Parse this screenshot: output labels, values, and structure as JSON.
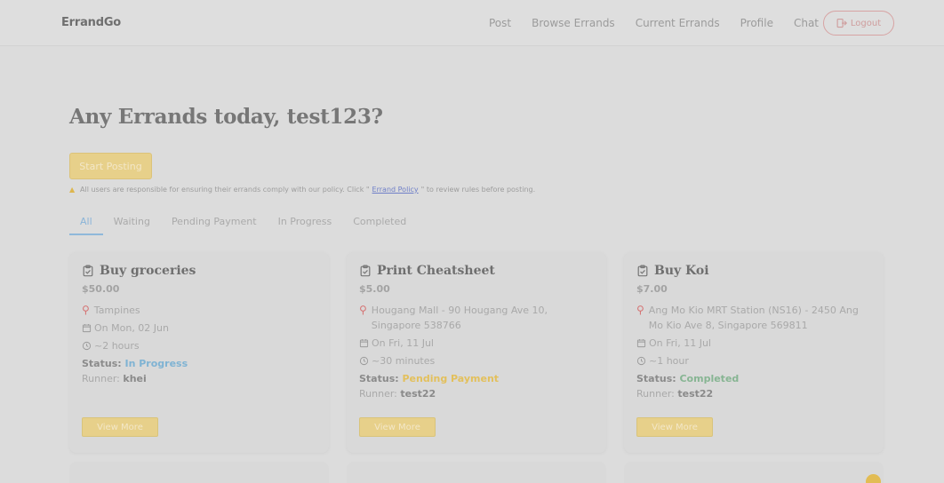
{
  "header": {
    "brand": "ErrandGo",
    "nav": [
      "Post",
      "Browse Errands",
      "Current Errands",
      "Profile",
      "Chat"
    ],
    "logout_label": "Logout"
  },
  "main": {
    "title": "Any Errands today, test123?",
    "start_label": "Start Posting",
    "policy_prefix": "All users are responsible for ensuring their errands comply with our policy. Click \"",
    "policy_link": "Errand Policy",
    "policy_suffix": "\" to review rules before posting.",
    "tabs": [
      "All",
      "Waiting",
      "Pending Payment",
      "In Progress",
      "Completed"
    ],
    "active_tab": "All"
  },
  "cards": [
    {
      "title": "Buy groceries",
      "price": "$50.00",
      "location": "Tampines",
      "date": "On Mon, 02 Jun",
      "duration": "~2 hours",
      "status_label": "Status:",
      "status": "In Progress",
      "runner_label": "Runner:",
      "runner": "khei",
      "status_color": "#7fb3d3",
      "button": "View More"
    },
    {
      "title": "Print Cheatsheet",
      "price": "$5.00",
      "location": "Hougang Mall - 90 Hougang Ave 10, Singapore 538766",
      "date": "On Fri, 11 Jul",
      "duration": "~30 minutes",
      "status_label": "Status:",
      "status": "Pending Payment",
      "runner_label": "Runner:",
      "runner": "test22",
      "status_color": "#e3c05c",
      "button": "View More"
    },
    {
      "title": "Buy Koi",
      "price": "$7.00",
      "location": "Ang Mo Kio MRT Station (NS16) - 2450 Ang Mo Kio Ave 8, Singapore 569811",
      "date": "On Fri, 11 Jul",
      "duration": "~1 hour",
      "status_label": "Status:",
      "status": "Completed",
      "runner_label": "Runner:",
      "runner": "test22",
      "status_color": "#87b593",
      "button": "View More"
    }
  ],
  "colors": {
    "accent": "#e7d08a",
    "logout_border": "#d7a3a3",
    "tab_active": "#8fb8da"
  }
}
